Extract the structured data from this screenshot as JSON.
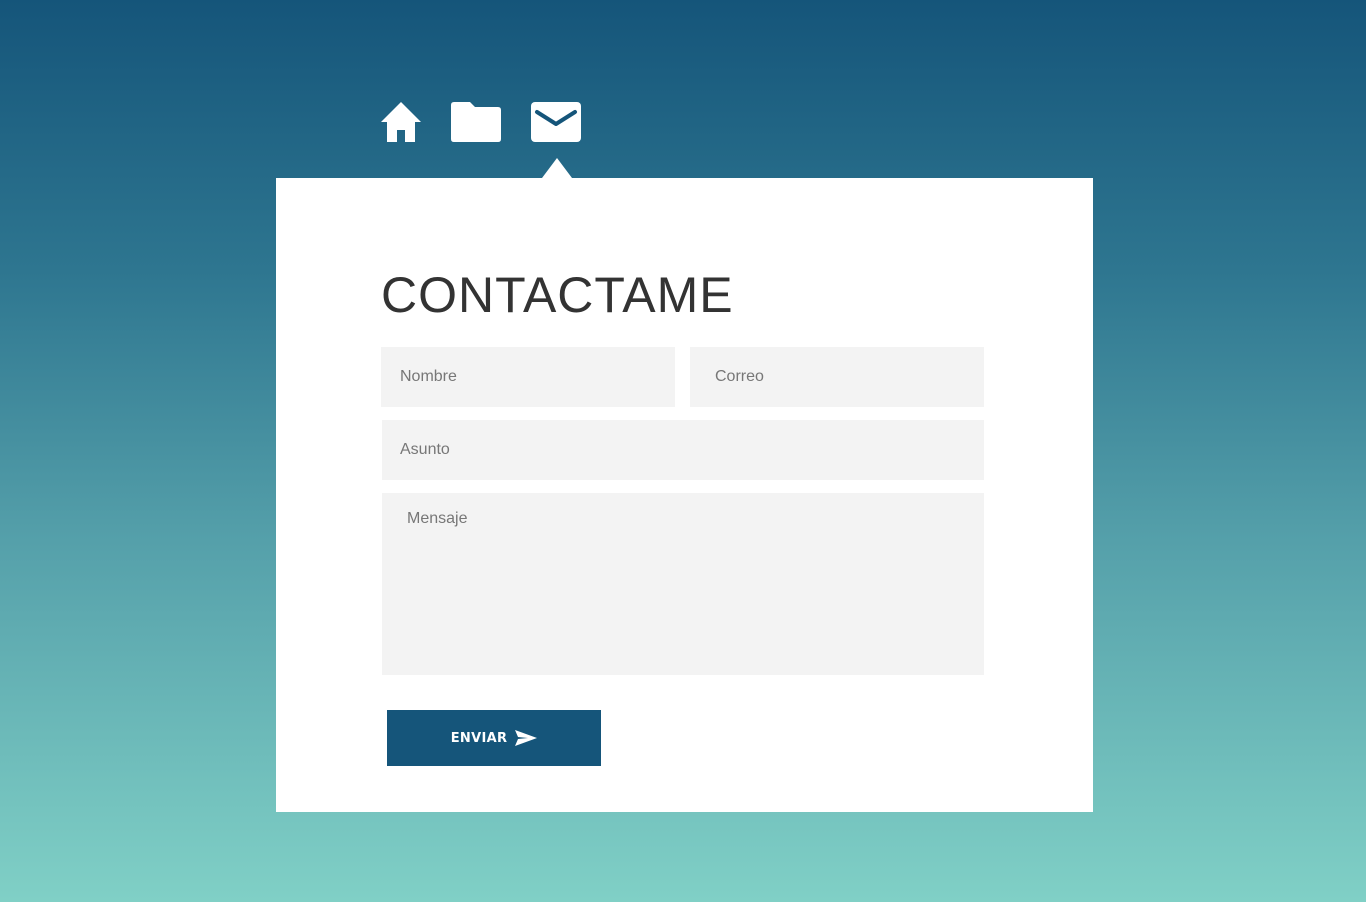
{
  "nav": {
    "items": [
      {
        "icon": "home-icon",
        "label": "Home"
      },
      {
        "icon": "folder-icon",
        "label": "Portfolio"
      },
      {
        "icon": "mail-icon",
        "label": "Contact",
        "active": true
      }
    ]
  },
  "contact": {
    "title": "CONTACTAME",
    "name_placeholder": "Nombre",
    "email_placeholder": "Correo",
    "subject_placeholder": "Asunto",
    "message_placeholder": "Mensaje",
    "send_label": "ENVIAR",
    "send_icon": "send-icon"
  },
  "colors": {
    "accent": "#15557a",
    "gradient_top": "#15557a",
    "gradient_bottom": "#80d0c6",
    "card": "#ffffff",
    "field_bg": "#f3f3f3",
    "title_text": "#333333"
  }
}
